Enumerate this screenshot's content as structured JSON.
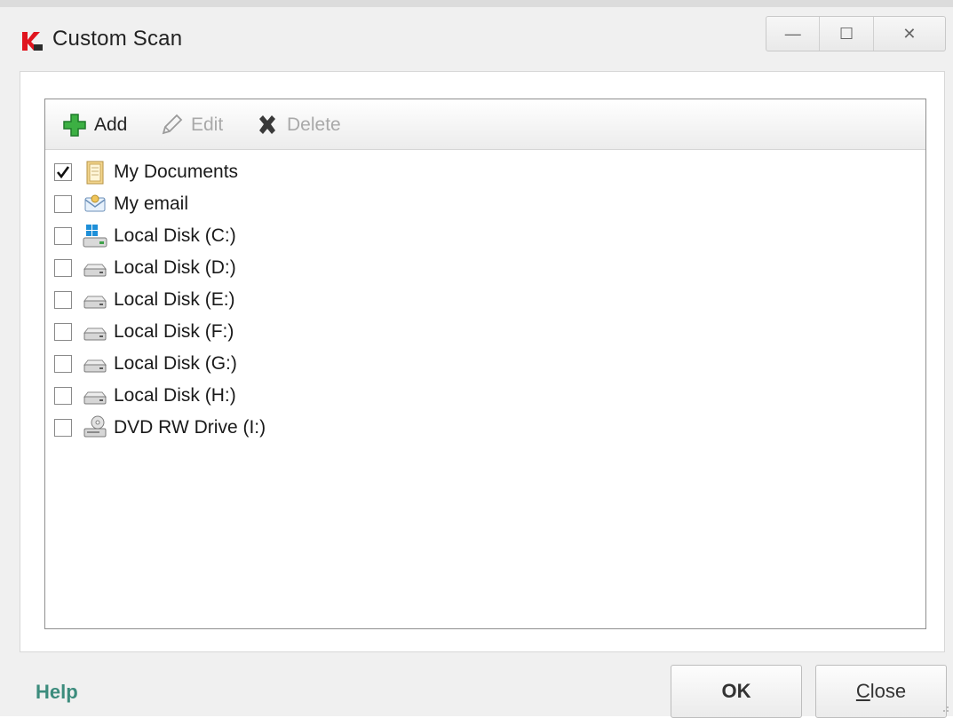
{
  "window": {
    "title": "Custom Scan",
    "controls": {
      "minimize": "—",
      "maximize": "☐",
      "close": "✕"
    }
  },
  "toolbar": {
    "add_label": "Add",
    "edit_label": "Edit",
    "delete_label": "Delete"
  },
  "items": [
    {
      "label": "My Documents",
      "checked": true,
      "icon": "folder-icon"
    },
    {
      "label": "My email",
      "checked": false,
      "icon": "email-icon"
    },
    {
      "label": "Local Disk (C:)",
      "checked": false,
      "icon": "system-drive-icon"
    },
    {
      "label": "Local Disk (D:)",
      "checked": false,
      "icon": "drive-icon"
    },
    {
      "label": "Local Disk (E:)",
      "checked": false,
      "icon": "drive-icon"
    },
    {
      "label": "Local Disk (F:)",
      "checked": false,
      "icon": "drive-icon"
    },
    {
      "label": "Local Disk (G:)",
      "checked": false,
      "icon": "drive-icon"
    },
    {
      "label": "Local Disk (H:)",
      "checked": false,
      "icon": "drive-icon"
    },
    {
      "label": "DVD RW Drive (I:)",
      "checked": false,
      "icon": "dvd-drive-icon"
    }
  ],
  "footer": {
    "help_label": "Help",
    "ok_label": "OK",
    "close_accel": "C",
    "close_rest": "lose"
  },
  "colors": {
    "help_link": "#3c8c7d",
    "add_icon": "#3cb043",
    "logo_red": "#e0141e"
  }
}
